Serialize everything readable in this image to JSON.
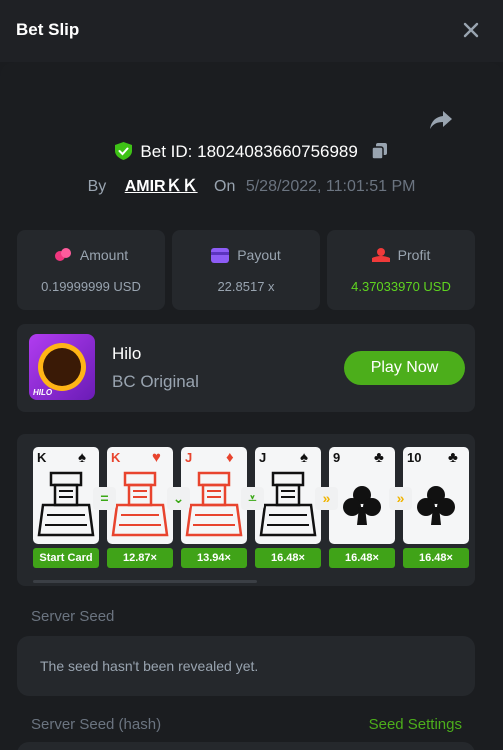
{
  "header": {
    "title": "Bet Slip"
  },
  "bet": {
    "id_label": "Bet ID:",
    "id": "18024083660756989",
    "by_label": "By",
    "user": "AMIRＫＫ",
    "on_label": "On",
    "date": "5/28/2022, 11:01:51 PM"
  },
  "stats": {
    "amount": {
      "label": "Amount",
      "value": "0.19999999 USD"
    },
    "payout": {
      "label": "Payout",
      "value": "22.8517 x"
    },
    "profit": {
      "label": "Profit",
      "value": "4.37033970 USD"
    }
  },
  "game": {
    "name": "Hilo",
    "provider": "BC Original",
    "thumb_tag": "HILO",
    "play_label": "Play Now"
  },
  "cards": [
    {
      "rank": "K",
      "suit": "♠",
      "color": "black",
      "multiplier": "Start Card"
    },
    {
      "rank": "K",
      "suit": "♥",
      "color": "red",
      "multiplier": "12.87×"
    },
    {
      "rank": "J",
      "suit": "♦",
      "color": "red",
      "multiplier": "13.94×"
    },
    {
      "rank": "J",
      "suit": "♠",
      "color": "black",
      "multiplier": "16.48×"
    },
    {
      "rank": "9",
      "suit": "♣",
      "color": "black",
      "multiplier": "16.48×"
    },
    {
      "rank": "10",
      "suit": "♣",
      "color": "black",
      "multiplier": "16.48×"
    }
  ],
  "guesses": [
    {
      "symbol": "=",
      "tone": "green"
    },
    {
      "symbol": "⌄",
      "tone": "green"
    },
    {
      "symbol": "⩡",
      "tone": "green"
    },
    {
      "symbol": "»",
      "tone": "yellow"
    },
    {
      "symbol": "»",
      "tone": "yellow"
    }
  ],
  "seeds": {
    "server_label": "Server Seed",
    "server_value": "The seed hasn't been revealed yet.",
    "hash_label": "Server Seed (hash)",
    "settings_label": "Seed Settings"
  },
  "colors": {
    "accent_green": "#4cae1b",
    "profit_green": "#5fd420",
    "panel": "#25282c",
    "background": "#1b1d20"
  },
  "icons": {
    "close": "close-icon",
    "share": "share-icon",
    "shield": "shield-check-icon",
    "copy": "copy-icon",
    "amount": "coins-icon",
    "payout": "wallet-icon",
    "profit": "profit-icon"
  }
}
